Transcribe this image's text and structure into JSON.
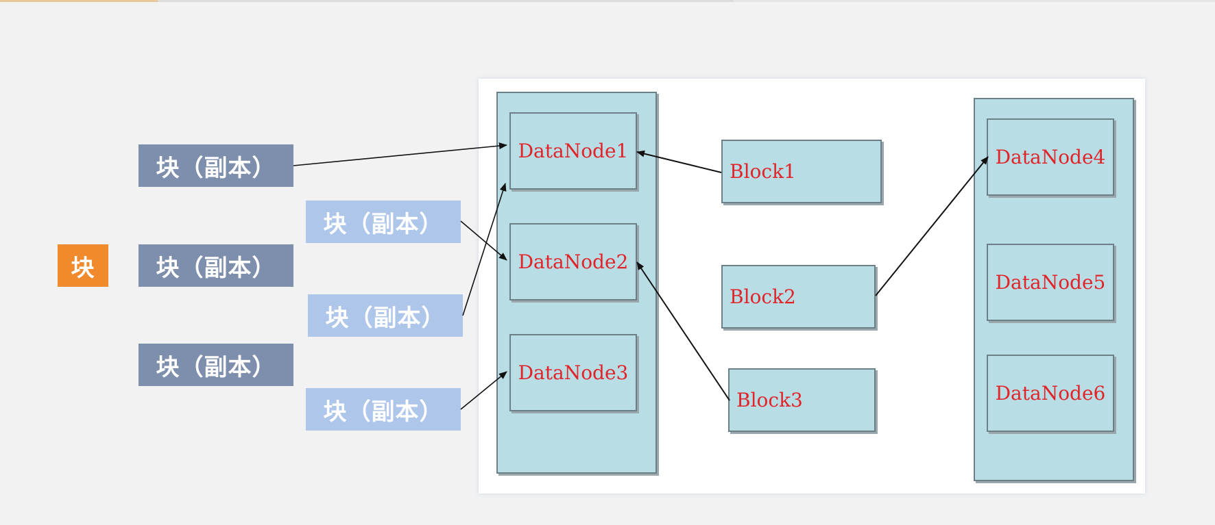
{
  "main_block": "块",
  "replicas": {
    "left": [
      "块（副本）",
      "块（副本）",
      "块（副本）"
    ],
    "right": [
      "块（副本）",
      "块（副本）",
      "块（副本）"
    ]
  },
  "datanodes_left": [
    "DataNode1",
    "DataNode2",
    "DataNode3"
  ],
  "datanodes_right": [
    "DataNode4",
    "DataNode5",
    "DataNode6"
  ],
  "blocks": [
    "Block1",
    "Block2",
    "Block3"
  ],
  "colors": {
    "main_block": "#f08a2c",
    "replica_dark": "#7d8fac",
    "replica_light": "#aec6ea",
    "node_fill": "#b9dde5",
    "node_text": "#e0242a"
  }
}
